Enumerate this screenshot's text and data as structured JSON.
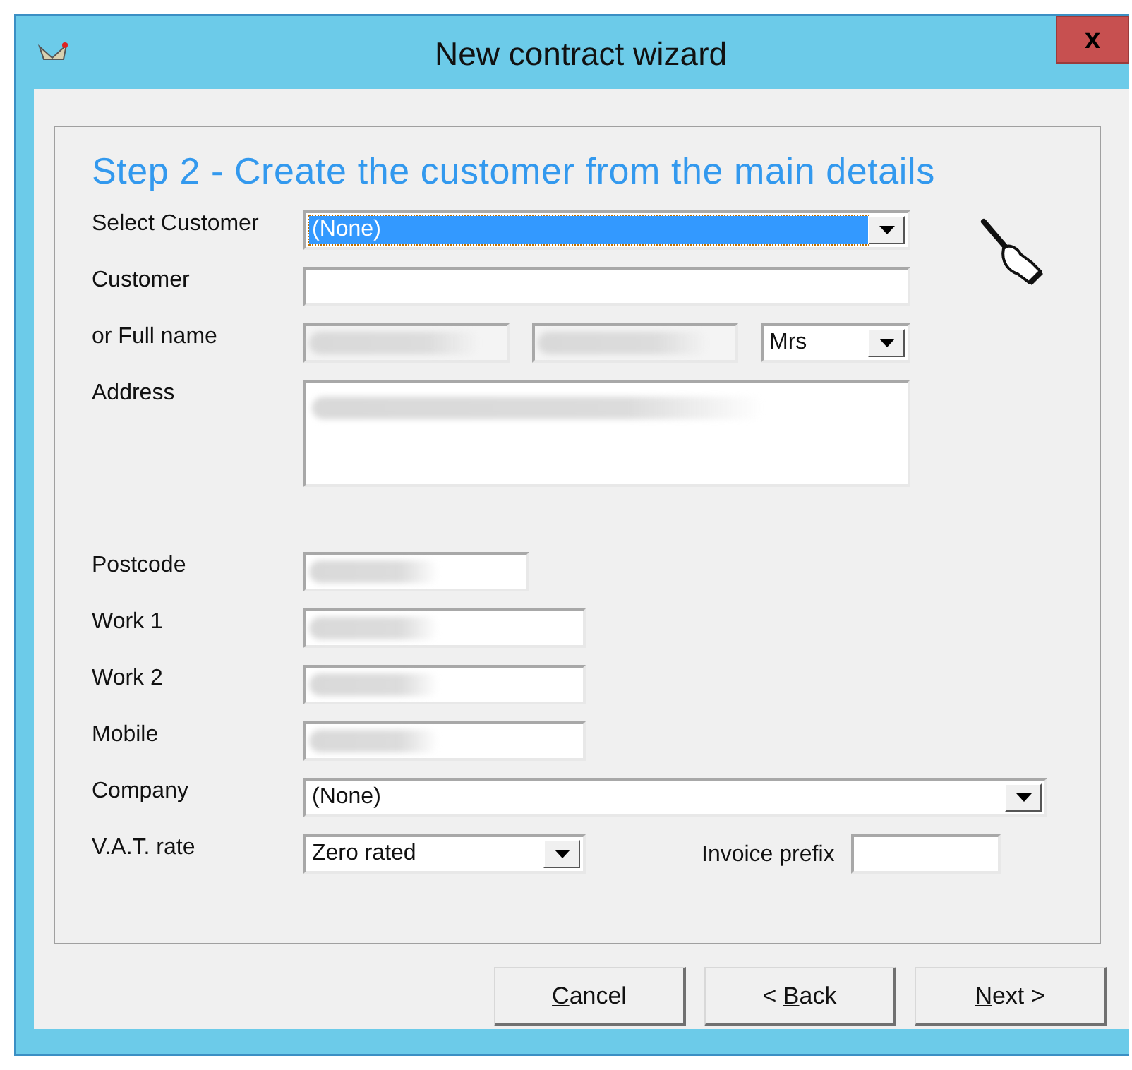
{
  "window": {
    "title": "New contract wizard",
    "close_glyph": "x"
  },
  "heading": "Step 2 - Create the customer from the main details",
  "fields": [
    {
      "kind": "dropdown",
      "label": "Select Customer",
      "value": "(None)",
      "highlighted": true
    },
    {
      "kind": "text",
      "label": "Customer"
    },
    {
      "kind": "fullname",
      "label": "or Full name",
      "title_value": "Mrs"
    },
    {
      "kind": "address",
      "label": "Address"
    },
    {
      "kind": "short",
      "label": "Postcode"
    },
    {
      "kind": "medium",
      "label": "Work 1"
    },
    {
      "kind": "medium",
      "label": "Work 2"
    },
    {
      "kind": "medium",
      "label": "Mobile"
    },
    {
      "kind": "wide_dropdown",
      "label": "Company",
      "value": "(None)",
      "highlighted": false
    },
    {
      "kind": "vat",
      "label": "V.A.T. rate",
      "value": "Zero rated",
      "prefix_label": "Invoice prefix"
    }
  ],
  "buttons": [
    {
      "mnemonic": "C",
      "after": "ancel"
    },
    {
      "before": "< ",
      "mnemonic": "B",
      "after": "ack"
    },
    {
      "mnemonic": "N",
      "after": "ext >"
    }
  ]
}
